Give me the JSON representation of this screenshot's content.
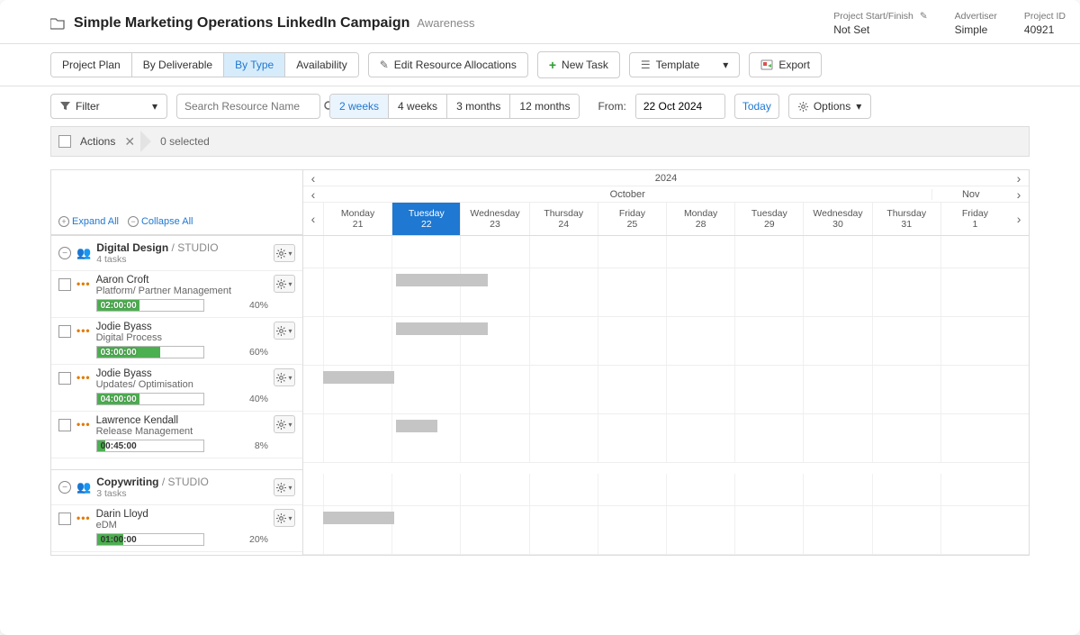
{
  "header": {
    "title": "Simple Marketing Operations LinkedIn Campaign",
    "subtitle": "Awareness",
    "meta": {
      "start_finish_label": "Project Start/Finish",
      "start_finish_value": "Not Set",
      "advertiser_label": "Advertiser",
      "advertiser_value": "Simple",
      "project_id_label": "Project ID",
      "project_id_value": "40921"
    }
  },
  "tabs": {
    "project_plan": "Project Plan",
    "by_deliverable": "By Deliverable",
    "by_type": "By Type",
    "availability": "Availability"
  },
  "toolbar": {
    "edit_allocations": "Edit Resource Allocations",
    "new_task": "New Task",
    "template": "Template",
    "export": "Export"
  },
  "filter": {
    "label": "Filter",
    "search_placeholder": "Search Resource Name",
    "ranges": {
      "w2": "2 weeks",
      "w4": "4 weeks",
      "m3": "3 months",
      "m12": "12 months"
    },
    "from_label": "From:",
    "date_value": "22 Oct 2024",
    "today": "Today",
    "options": "Options"
  },
  "actions_bar": {
    "actions": "Actions",
    "selected": "0 selected"
  },
  "controls": {
    "expand_all": "Expand All",
    "collapse_all": "Collapse All"
  },
  "timeline": {
    "year": "2024",
    "months": {
      "m1": "October",
      "m2": "Nov"
    },
    "days": [
      {
        "name": "Monday",
        "num": "21"
      },
      {
        "name": "Tuesday",
        "num": "22",
        "active": true
      },
      {
        "name": "Wednesday",
        "num": "23"
      },
      {
        "name": "Thursday",
        "num": "24"
      },
      {
        "name": "Friday",
        "num": "25"
      },
      {
        "name": "Monday",
        "num": "28"
      },
      {
        "name": "Tuesday",
        "num": "29"
      },
      {
        "name": "Wednesday",
        "num": "30"
      },
      {
        "name": "Thursday",
        "num": "31"
      },
      {
        "name": "Friday",
        "num": "1"
      }
    ]
  },
  "groups": [
    {
      "name": "Digital Design",
      "studio": "STUDIO",
      "task_count": "4 tasks",
      "tasks": [
        {
          "person": "Aaron Croft",
          "role": "Platform/ Partner Management",
          "time": "02:00:00",
          "pct": "40%",
          "fill": 40,
          "bar_start": 1,
          "bar_span": 1.3
        },
        {
          "person": "Jodie Byass",
          "role": "Digital Process",
          "time": "03:00:00",
          "pct": "60%",
          "fill": 60,
          "bar_start": 1,
          "bar_span": 1.3
        },
        {
          "person": "Jodie Byass",
          "role": "Updates/ Optimisation",
          "time": "04:00:00",
          "pct": "40%",
          "fill": 40,
          "bar_start": 0,
          "bar_span": 1
        },
        {
          "person": "Lawrence Kendall",
          "role": "Release Management",
          "time": "00:45:00",
          "pct": "8%",
          "fill": 8,
          "bar_start": 1,
          "bar_span": 0.6,
          "time_dark": true
        }
      ]
    },
    {
      "name": "Copywriting",
      "studio": "STUDIO",
      "task_count": "3 tasks",
      "tasks": [
        {
          "person": "Darin Lloyd",
          "role": "eDM",
          "time": "01:00:00",
          "pct": "20%",
          "fill": 25,
          "bar_start": 0,
          "bar_span": 1,
          "time_dark": true
        }
      ]
    }
  ]
}
